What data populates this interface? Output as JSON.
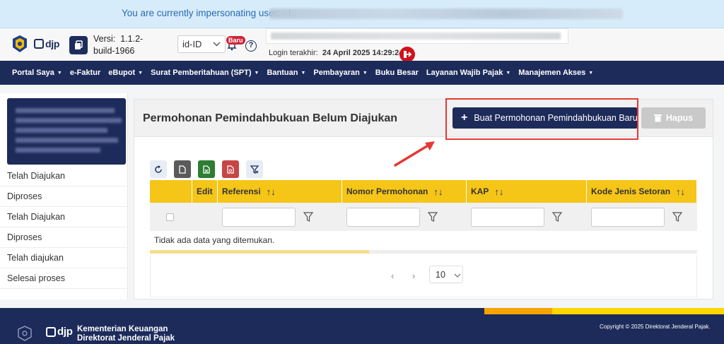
{
  "banner": {
    "text": "You are currently impersonating user: - !"
  },
  "header": {
    "logo": "djp",
    "version_label": "Versi:",
    "version_value": "1.1.2-build-1966",
    "language": "id-ID",
    "new_badge": "Baru",
    "last_login_label": "Login terakhir:",
    "last_login_value": "24 April 2025 14:29:24"
  },
  "nav": {
    "items": [
      {
        "label": "Portal Saya",
        "has_menu": true
      },
      {
        "label": "e-Faktur",
        "has_menu": false
      },
      {
        "label": "eBupot",
        "has_menu": true
      },
      {
        "label": "Surat Pemberitahuan (SPT)",
        "has_menu": true
      },
      {
        "label": "Bantuan",
        "has_menu": true
      },
      {
        "label": "Pembayaran",
        "has_menu": true
      },
      {
        "label": "Buku Besar",
        "has_menu": false
      },
      {
        "label": "Layanan Wajib Pajak",
        "has_menu": true
      },
      {
        "label": "Manajemen Akses",
        "has_menu": true
      }
    ]
  },
  "sidebar": {
    "items": [
      {
        "label": "Telah Diajukan"
      },
      {
        "label": "Diproses"
      },
      {
        "label": "Telah Diajukan"
      },
      {
        "label": "Diproses"
      },
      {
        "label": "Telah diajukan"
      },
      {
        "label": "Selesai proses"
      }
    ]
  },
  "main": {
    "title": "Permohonan Pemindahbukuan Belum Diajukan",
    "create_button": "Buat Permohonan Pemindahbukuan Baru",
    "delete_button": "Hapus",
    "table": {
      "columns": [
        "",
        "Edit",
        "Referensi",
        "Nomor Permohonan",
        "KAP",
        "Kode Jenis Setoran"
      ],
      "empty_message": "Tidak ada data yang ditemukan.",
      "page_size": "10"
    }
  },
  "footer": {
    "logo": "djp",
    "org_line1": "Kementerian Keuangan",
    "org_line2": "Direktorat Jenderal Pajak",
    "copyright": "Copyright © 2025 Direktorat Jenderal Pajak."
  },
  "colors": {
    "navy": "#1d2b5a",
    "table_header": "#f5c518",
    "highlight": "#e53935",
    "logout": "#d0121b"
  }
}
